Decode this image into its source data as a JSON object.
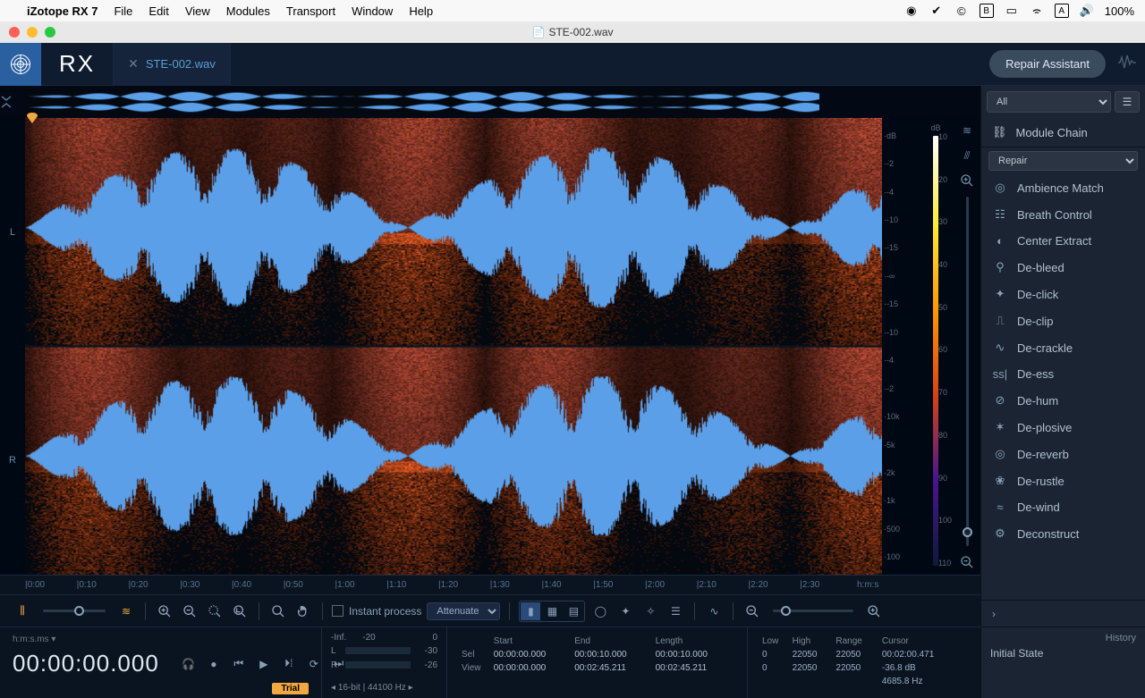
{
  "mac_menu": {
    "app": "iZotope RX 7",
    "items": [
      "File",
      "Edit",
      "View",
      "Modules",
      "Transport",
      "Window",
      "Help"
    ],
    "battery": "100%"
  },
  "titlebar": {
    "doc": "STE-002.wav"
  },
  "header": {
    "file_tab": "STE-002.wav",
    "repair_btn": "Repair Assistant"
  },
  "channels": {
    "left": "L",
    "right": "R"
  },
  "freq_labels": [
    "dB",
    "-2",
    "-4",
    "-10",
    "-15",
    "-∞",
    "-15",
    "-10",
    "-4",
    "-2",
    "10k",
    "5k",
    "2k",
    "1k",
    "500",
    "100"
  ],
  "db_scale": {
    "unit": "dB",
    "ticks": [
      "10",
      "20",
      "30",
      "40",
      "50",
      "60",
      "70",
      "80",
      "90",
      "100",
      "110"
    ]
  },
  "time_ruler": {
    "marks": [
      "0:00",
      "0:10",
      "0:20",
      "0:30",
      "0:40",
      "0:50",
      "1:00",
      "1:10",
      "1:20",
      "1:30",
      "1:40",
      "1:50",
      "2:00",
      "2:10",
      "2:20",
      "2:30"
    ],
    "unit": "h:m:s"
  },
  "toolbar": {
    "instant_process": "Instant process",
    "attenuate": "Attenuate"
  },
  "time_block": {
    "unit": "h:m:s.ms ▾",
    "big": "00:00:00.000",
    "trial": "Trial"
  },
  "meter": {
    "inf": "-Inf.",
    "n20": "-20",
    "zero": "0",
    "L": "L",
    "R": "R",
    "Lval": "-30",
    "Rval": "-26"
  },
  "sel": {
    "hdr": [
      "Start",
      "End",
      "Length"
    ],
    "rows": [
      [
        "Sel",
        "00:00:00.000",
        "00:00:10.000",
        "00:00:10.000"
      ],
      [
        "View",
        "00:00:00.000",
        "00:02:45.211",
        "00:02:45.211"
      ]
    ]
  },
  "freq": {
    "hdr": [
      "Low",
      "High",
      "Range",
      "Cursor"
    ],
    "row": [
      "0",
      "22050",
      "22050",
      "00:02:00.471"
    ],
    "row2": [
      "0",
      "22050",
      "22050",
      "-36.8 dB"
    ],
    "row3": "4685.8 Hz"
  },
  "bitrate": "16-bit | 44100 Hz",
  "side": {
    "filter": "All",
    "module_chain": "Module Chain",
    "category": "Repair",
    "modules": [
      "Ambience Match",
      "Breath Control",
      "Center Extract",
      "De-bleed",
      "De-click",
      "De-clip",
      "De-crackle",
      "De-ess",
      "De-hum",
      "De-plosive",
      "De-reverb",
      "De-rustle",
      "De-wind",
      "Deconstruct"
    ]
  },
  "history": {
    "title": "History",
    "state": "Initial State"
  }
}
